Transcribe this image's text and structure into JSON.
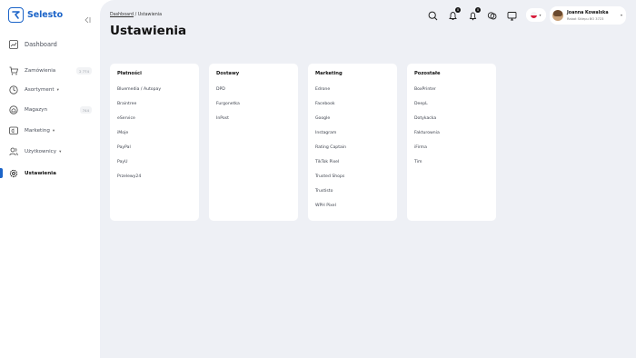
{
  "brand": {
    "name": "Selesto",
    "accent": "#1c64c8"
  },
  "sidebar": {
    "items": [
      {
        "label": "Dashboard",
        "icon": "chart-icon"
      },
      {
        "label": "Zamówienia",
        "icon": "cart-icon",
        "badge": "2 774"
      },
      {
        "label": "Asortyment",
        "icon": "box-icon",
        "has_submenu": true
      },
      {
        "label": "Magazyn",
        "icon": "warehouse-icon",
        "badge": "744"
      },
      {
        "label": "Marketing",
        "icon": "megaphone-icon",
        "has_submenu": true
      },
      {
        "label": "Użytkownicy",
        "icon": "users-icon",
        "has_submenu": true
      },
      {
        "label": "Ustawienia",
        "icon": "gear-icon",
        "active": true
      }
    ]
  },
  "header": {
    "breadcrumb_root": "Dashboard",
    "breadcrumb_separator": "/",
    "breadcrumb_current": "Ustawienia",
    "title": "Ustawienia",
    "icons": [
      "search-icon",
      "bell-icon",
      "notification-icon",
      "chat-icon",
      "monitor-icon"
    ],
    "notification_counts": {
      "bell": "0",
      "notification": "0"
    },
    "language": "pl",
    "user": {
      "name": "Joanna Kowalska",
      "role": "Rabat Sklepu BO 3723"
    }
  },
  "cards": [
    {
      "title": "Płatności",
      "items": [
        "Bluemedia / Autopay",
        "Braintree",
        "eService",
        "iMoje",
        "PayPal",
        "PayU",
        "Przelewy24"
      ]
    },
    {
      "title": "Dostawy",
      "items": [
        "DPD",
        "Furgonetka",
        "InPost"
      ]
    },
    {
      "title": "Marketing",
      "items": [
        "Edrone",
        "Facebook",
        "Google",
        "Instagram",
        "Rating Captain",
        "TikTok Pixel",
        "Trusted Shops",
        "Trustisto",
        "WPH Pixel"
      ]
    },
    {
      "title": "Pozostałe",
      "items": [
        "BoxPrinter",
        "DeepL",
        "Dotykacka",
        "Fakturownia",
        "iFirma",
        "Tim"
      ]
    }
  ]
}
